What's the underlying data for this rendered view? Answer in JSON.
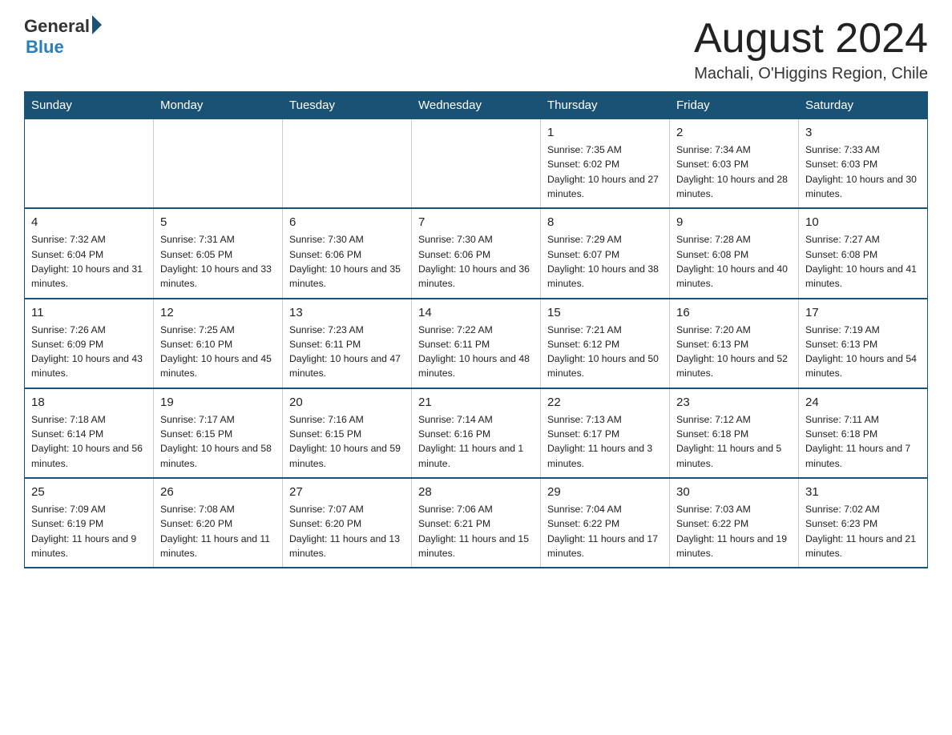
{
  "logo": {
    "general": "General",
    "blue": "Blue"
  },
  "title": "August 2024",
  "location": "Machali, O'Higgins Region, Chile",
  "days_of_week": [
    "Sunday",
    "Monday",
    "Tuesday",
    "Wednesday",
    "Thursday",
    "Friday",
    "Saturday"
  ],
  "weeks": [
    [
      {
        "day": "",
        "info": ""
      },
      {
        "day": "",
        "info": ""
      },
      {
        "day": "",
        "info": ""
      },
      {
        "day": "",
        "info": ""
      },
      {
        "day": "1",
        "info": "Sunrise: 7:35 AM\nSunset: 6:02 PM\nDaylight: 10 hours and 27 minutes."
      },
      {
        "day": "2",
        "info": "Sunrise: 7:34 AM\nSunset: 6:03 PM\nDaylight: 10 hours and 28 minutes."
      },
      {
        "day": "3",
        "info": "Sunrise: 7:33 AM\nSunset: 6:03 PM\nDaylight: 10 hours and 30 minutes."
      }
    ],
    [
      {
        "day": "4",
        "info": "Sunrise: 7:32 AM\nSunset: 6:04 PM\nDaylight: 10 hours and 31 minutes."
      },
      {
        "day": "5",
        "info": "Sunrise: 7:31 AM\nSunset: 6:05 PM\nDaylight: 10 hours and 33 minutes."
      },
      {
        "day": "6",
        "info": "Sunrise: 7:30 AM\nSunset: 6:06 PM\nDaylight: 10 hours and 35 minutes."
      },
      {
        "day": "7",
        "info": "Sunrise: 7:30 AM\nSunset: 6:06 PM\nDaylight: 10 hours and 36 minutes."
      },
      {
        "day": "8",
        "info": "Sunrise: 7:29 AM\nSunset: 6:07 PM\nDaylight: 10 hours and 38 minutes."
      },
      {
        "day": "9",
        "info": "Sunrise: 7:28 AM\nSunset: 6:08 PM\nDaylight: 10 hours and 40 minutes."
      },
      {
        "day": "10",
        "info": "Sunrise: 7:27 AM\nSunset: 6:08 PM\nDaylight: 10 hours and 41 minutes."
      }
    ],
    [
      {
        "day": "11",
        "info": "Sunrise: 7:26 AM\nSunset: 6:09 PM\nDaylight: 10 hours and 43 minutes."
      },
      {
        "day": "12",
        "info": "Sunrise: 7:25 AM\nSunset: 6:10 PM\nDaylight: 10 hours and 45 minutes."
      },
      {
        "day": "13",
        "info": "Sunrise: 7:23 AM\nSunset: 6:11 PM\nDaylight: 10 hours and 47 minutes."
      },
      {
        "day": "14",
        "info": "Sunrise: 7:22 AM\nSunset: 6:11 PM\nDaylight: 10 hours and 48 minutes."
      },
      {
        "day": "15",
        "info": "Sunrise: 7:21 AM\nSunset: 6:12 PM\nDaylight: 10 hours and 50 minutes."
      },
      {
        "day": "16",
        "info": "Sunrise: 7:20 AM\nSunset: 6:13 PM\nDaylight: 10 hours and 52 minutes."
      },
      {
        "day": "17",
        "info": "Sunrise: 7:19 AM\nSunset: 6:13 PM\nDaylight: 10 hours and 54 minutes."
      }
    ],
    [
      {
        "day": "18",
        "info": "Sunrise: 7:18 AM\nSunset: 6:14 PM\nDaylight: 10 hours and 56 minutes."
      },
      {
        "day": "19",
        "info": "Sunrise: 7:17 AM\nSunset: 6:15 PM\nDaylight: 10 hours and 58 minutes."
      },
      {
        "day": "20",
        "info": "Sunrise: 7:16 AM\nSunset: 6:15 PM\nDaylight: 10 hours and 59 minutes."
      },
      {
        "day": "21",
        "info": "Sunrise: 7:14 AM\nSunset: 6:16 PM\nDaylight: 11 hours and 1 minute."
      },
      {
        "day": "22",
        "info": "Sunrise: 7:13 AM\nSunset: 6:17 PM\nDaylight: 11 hours and 3 minutes."
      },
      {
        "day": "23",
        "info": "Sunrise: 7:12 AM\nSunset: 6:18 PM\nDaylight: 11 hours and 5 minutes."
      },
      {
        "day": "24",
        "info": "Sunrise: 7:11 AM\nSunset: 6:18 PM\nDaylight: 11 hours and 7 minutes."
      }
    ],
    [
      {
        "day": "25",
        "info": "Sunrise: 7:09 AM\nSunset: 6:19 PM\nDaylight: 11 hours and 9 minutes."
      },
      {
        "day": "26",
        "info": "Sunrise: 7:08 AM\nSunset: 6:20 PM\nDaylight: 11 hours and 11 minutes."
      },
      {
        "day": "27",
        "info": "Sunrise: 7:07 AM\nSunset: 6:20 PM\nDaylight: 11 hours and 13 minutes."
      },
      {
        "day": "28",
        "info": "Sunrise: 7:06 AM\nSunset: 6:21 PM\nDaylight: 11 hours and 15 minutes."
      },
      {
        "day": "29",
        "info": "Sunrise: 7:04 AM\nSunset: 6:22 PM\nDaylight: 11 hours and 17 minutes."
      },
      {
        "day": "30",
        "info": "Sunrise: 7:03 AM\nSunset: 6:22 PM\nDaylight: 11 hours and 19 minutes."
      },
      {
        "day": "31",
        "info": "Sunrise: 7:02 AM\nSunset: 6:23 PM\nDaylight: 11 hours and 21 minutes."
      }
    ]
  ]
}
